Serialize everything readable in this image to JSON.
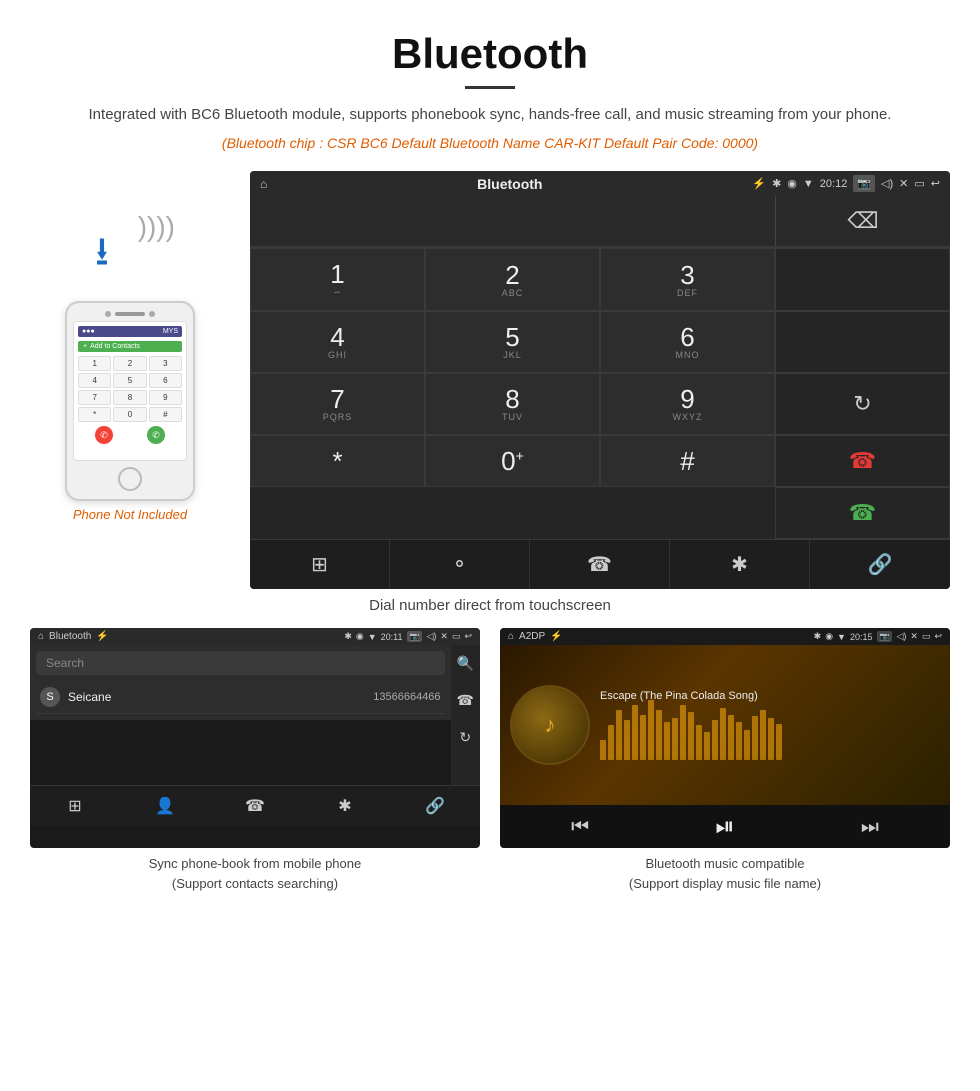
{
  "page": {
    "title": "Bluetooth",
    "divider": true,
    "description": "Integrated with BC6 Bluetooth module, supports phonebook sync, hands-free call, and music streaming from your phone.",
    "specs": "(Bluetooth chip : CSR BC6    Default Bluetooth Name CAR-KIT    Default Pair Code: 0000)",
    "phone_not_included": "Phone Not Included"
  },
  "car_screen": {
    "status_bar": {
      "home_icon": "⌂",
      "title": "Bluetooth",
      "usb_icon": "⚡",
      "bluetooth_icon": "✱",
      "location_icon": "◉",
      "signal_icon": "▼",
      "time": "20:12",
      "camera_icon": "📷",
      "volume_icon": "◁)",
      "close_icon": "✕",
      "window_icon": "▭",
      "back_icon": "↩"
    },
    "dialer": {
      "keys": [
        {
          "num": "1",
          "sub": "∽",
          "row": 0,
          "col": 0
        },
        {
          "num": "2",
          "sub": "ABC",
          "row": 0,
          "col": 1
        },
        {
          "num": "3",
          "sub": "DEF",
          "row": 0,
          "col": 2
        },
        {
          "num": "4",
          "sub": "GHI",
          "row": 1,
          "col": 0
        },
        {
          "num": "5",
          "sub": "JKL",
          "row": 1,
          "col": 1
        },
        {
          "num": "6",
          "sub": "MNO",
          "row": 1,
          "col": 2
        },
        {
          "num": "7",
          "sub": "PQRS",
          "row": 2,
          "col": 0
        },
        {
          "num": "8",
          "sub": "TUV",
          "row": 2,
          "col": 1
        },
        {
          "num": "9",
          "sub": "WXYZ",
          "row": 2,
          "col": 2
        },
        {
          "num": "*",
          "sub": "",
          "row": 3,
          "col": 0
        },
        {
          "num": "0",
          "sub": "+",
          "row": 3,
          "col": 1
        },
        {
          "num": "#",
          "sub": "",
          "row": 3,
          "col": 2
        }
      ]
    },
    "bottom_nav": [
      "⊞",
      "👤",
      "☎",
      "✱",
      "🔗"
    ]
  },
  "main_caption": "Dial number direct from touchscreen",
  "phonebook_screen": {
    "status_bar": {
      "home_icon": "⌂",
      "title": "Bluetooth",
      "usb_icon": "⚡",
      "bt_icon": "✱",
      "loc_icon": "◉",
      "sig_icon": "▼",
      "time": "20:11",
      "camera_icon": "📷",
      "vol_icon": "◁)",
      "close_icon": "✕",
      "win_icon": "▭",
      "back_icon": "↩"
    },
    "search_placeholder": "Search",
    "contacts": [
      {
        "letter": "S",
        "name": "Seicane",
        "number": "13566664466"
      }
    ],
    "side_icons": [
      "🔍",
      "📞",
      "🔄"
    ],
    "bottom_nav": [
      "⊞",
      "👤",
      "📞",
      "✱",
      "🔗"
    ],
    "active_nav": 1
  },
  "phonebook_caption": "Sync phone-book from mobile phone\n(Support contacts searching)",
  "music_screen": {
    "status_bar": {
      "home_icon": "⌂",
      "title": "A2DP",
      "usb_icon": "⚡",
      "bt_icon": "✱",
      "loc_icon": "◉",
      "sig_icon": "▼",
      "time": "20:15",
      "camera_icon": "📷",
      "vol_icon": "◁)",
      "close_icon": "✕",
      "win_icon": "▭",
      "back_icon": "↩"
    },
    "song_title": "Escape (The Pina Colada Song)",
    "album_icon": "♪",
    "bt_center_icon": "✱",
    "controls": {
      "prev": "⏮",
      "play_pause": "⏯",
      "next": "⏭"
    },
    "viz_bars": [
      20,
      35,
      50,
      40,
      55,
      45,
      60,
      50,
      38,
      42,
      55,
      48,
      35,
      28,
      40,
      52,
      45,
      38,
      30,
      44,
      50,
      42,
      36
    ]
  },
  "music_caption": "Bluetooth music compatible\n(Support display music file name)"
}
